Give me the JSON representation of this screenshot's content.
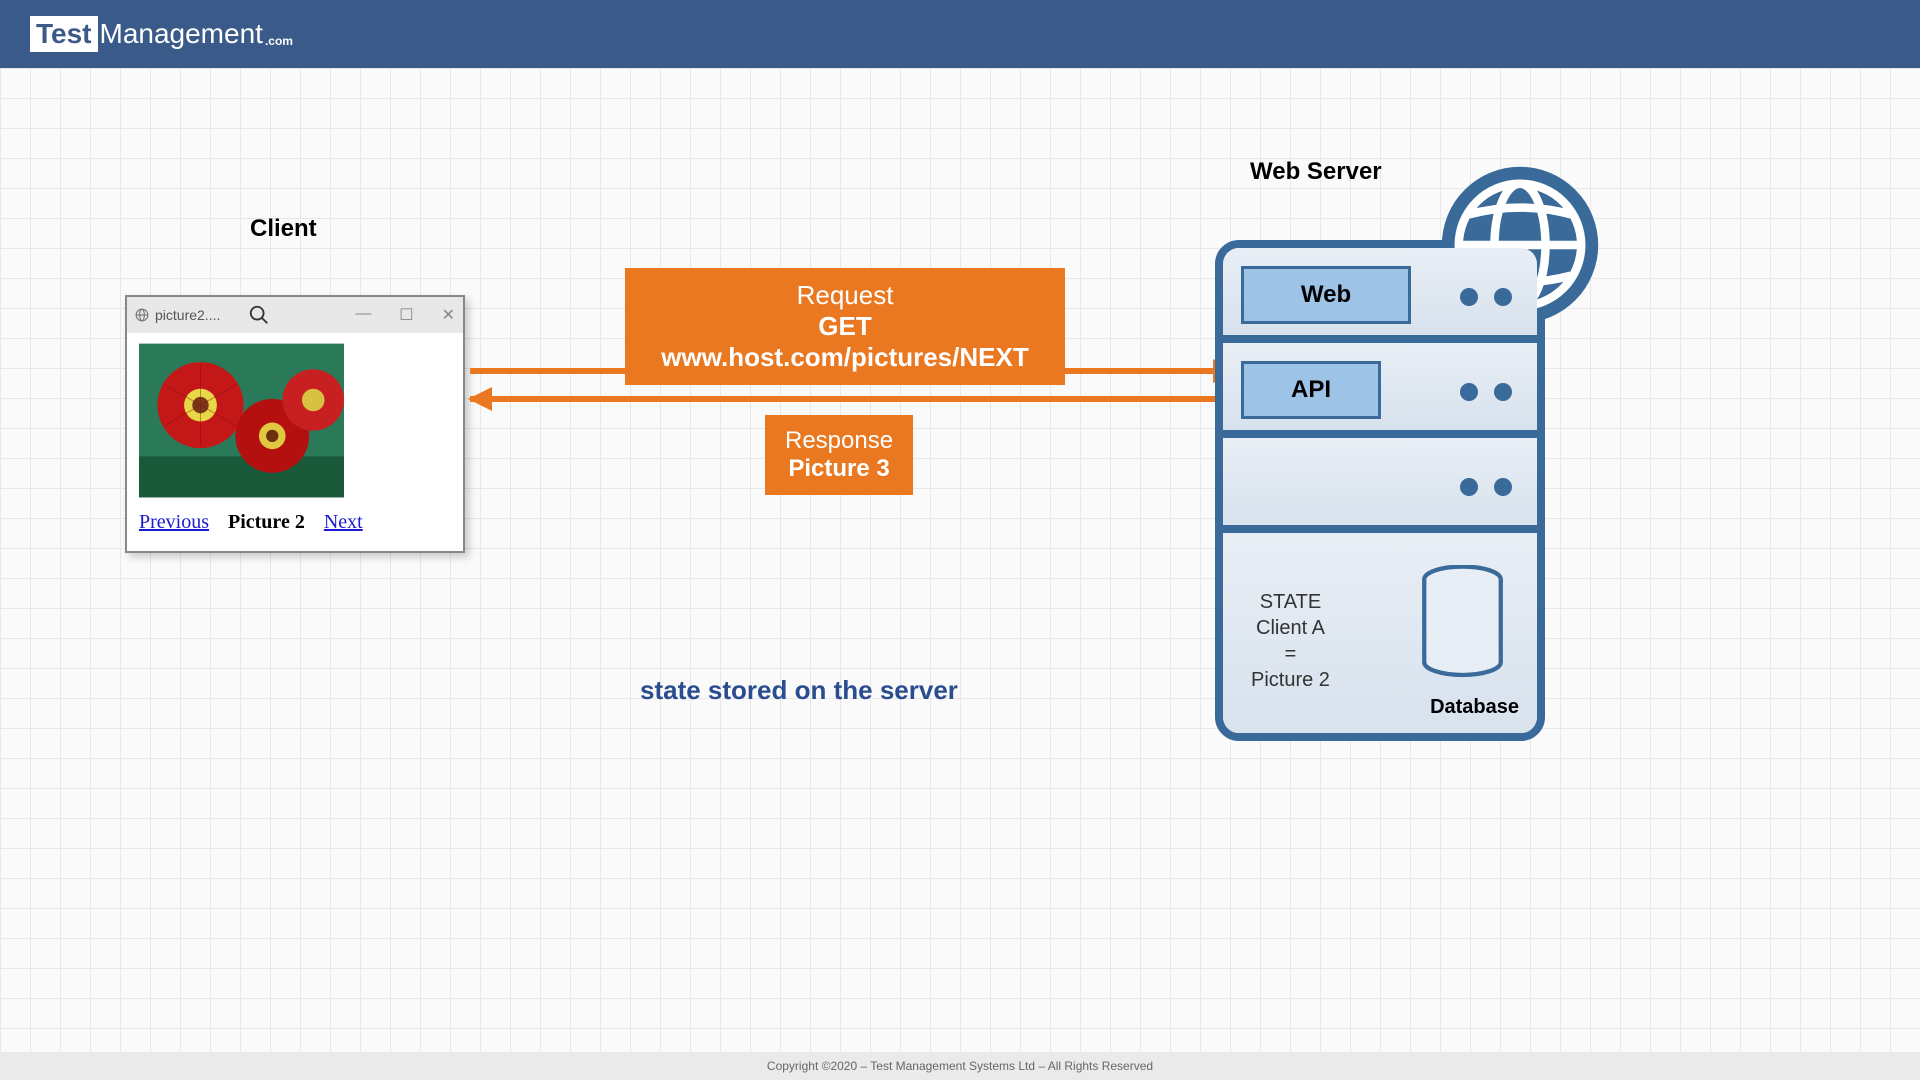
{
  "header": {
    "logo_test": "Test",
    "logo_mgmt": "Management",
    "logo_com": ".com"
  },
  "labels": {
    "client": "Client",
    "server": "Web Server",
    "state_note": "state stored on the server"
  },
  "browser": {
    "tab_title": "picture2....",
    "prev": "Previous",
    "current": "Picture 2",
    "next": "Next"
  },
  "request": {
    "title": "Request",
    "detail": "GET www.host.com/pictures/NEXT"
  },
  "response": {
    "title": "Response",
    "detail": "Picture 3"
  },
  "server": {
    "web": "Web",
    "api": "API",
    "database": "Database",
    "state": {
      "title": "STATE",
      "client": "Client A",
      "eq": "=",
      "value": "Picture 2"
    }
  },
  "footer": {
    "copyright": "Copyright ©2020 – Test Management Systems Ltd – All Rights Reserved"
  }
}
